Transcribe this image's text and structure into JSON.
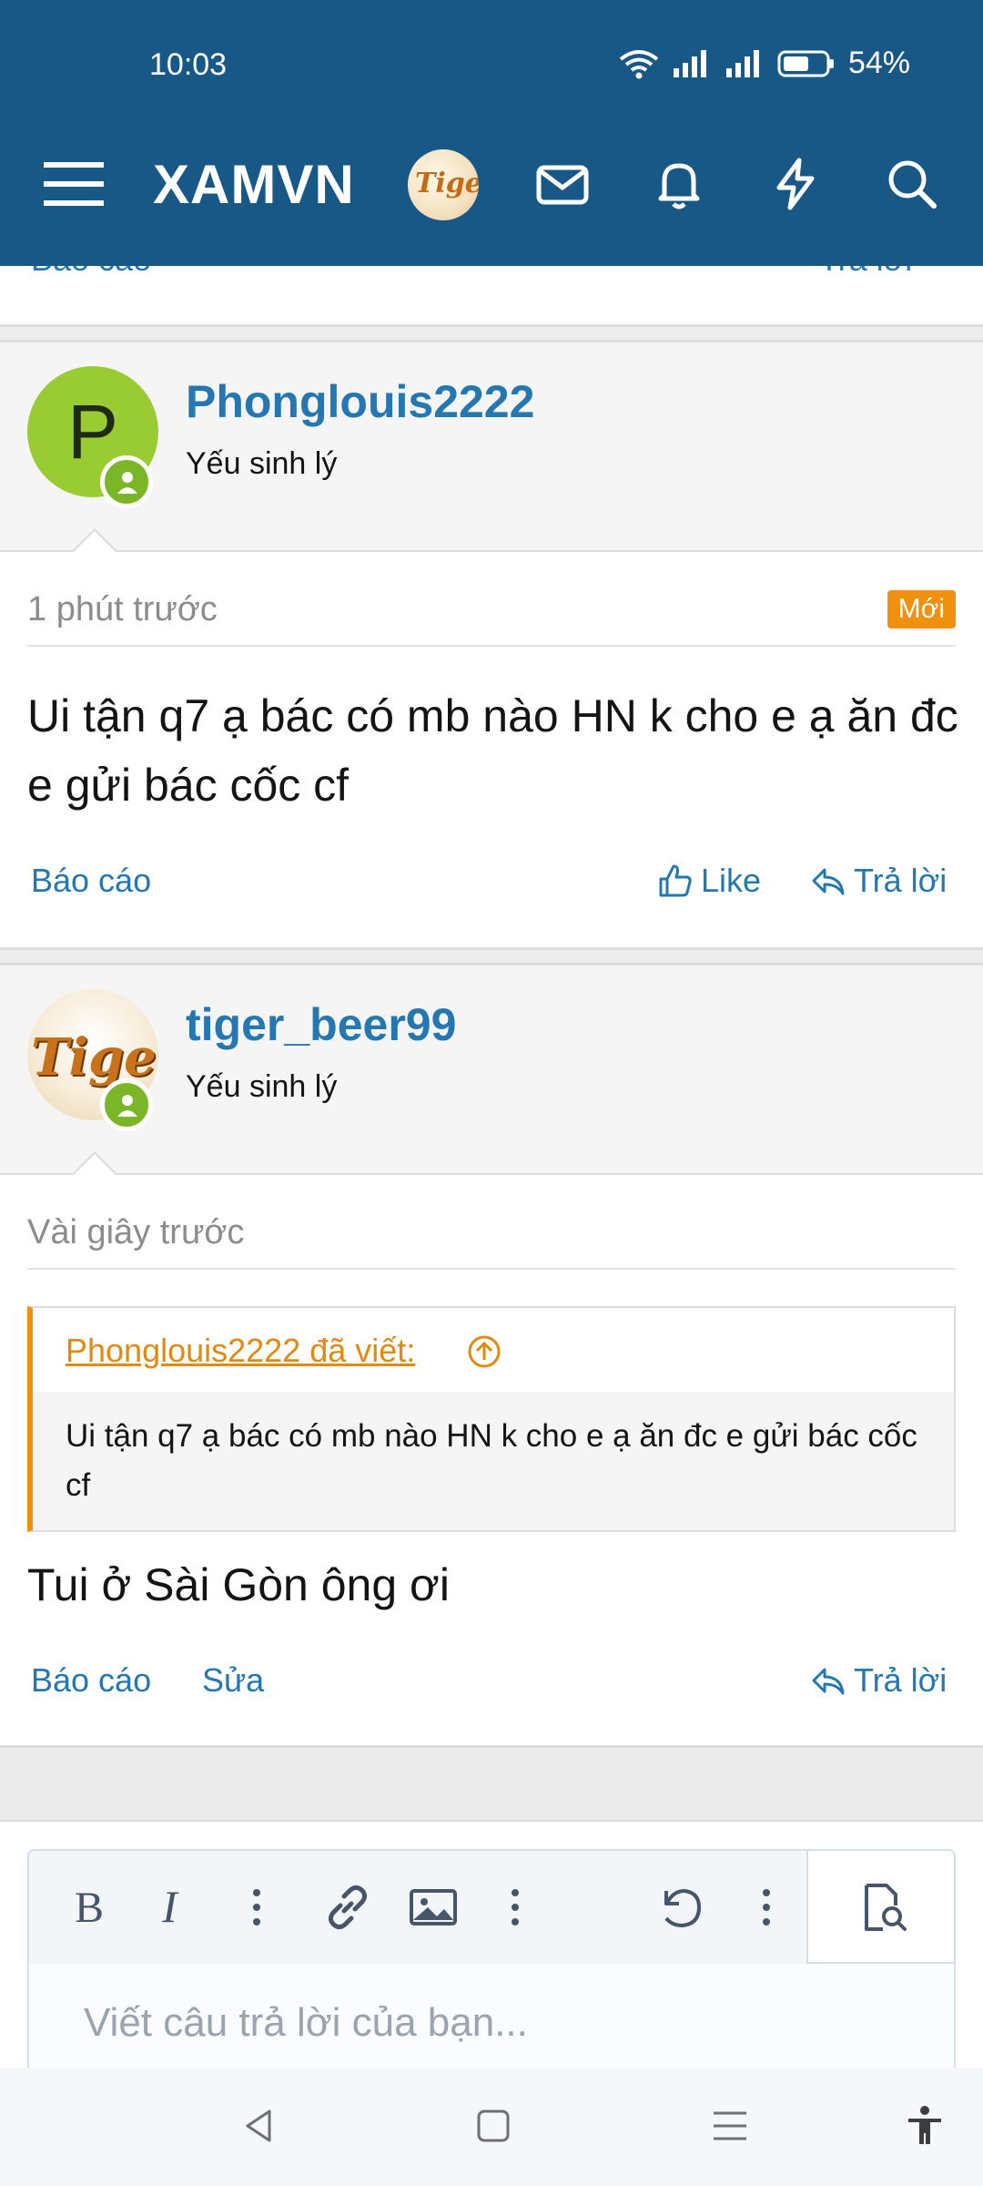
{
  "status_bar": {
    "time": "10:03",
    "battery": "54%"
  },
  "app_bar": {
    "brand": "XAMVN",
    "logo_text": "Tiger",
    "icons": [
      "menu-icon",
      "mail-icon",
      "bell-icon",
      "lightning-icon",
      "search-icon"
    ]
  },
  "prev_post": {
    "report": "Báo cáo",
    "reply": "Trả lời"
  },
  "posts": [
    {
      "avatar_letter": "P",
      "username": "Phonglouis2222",
      "user_title": "Yếu sinh lý",
      "time": "1 phút trước",
      "badge": "Mới",
      "text": "Ui tận q7 ạ bác có mb nào HN k cho e ạ ăn đc e gửi bác cốc cf",
      "actions": {
        "report": "Báo cáo",
        "like": "Like",
        "reply": "Trả lời"
      }
    },
    {
      "avatar_text": "Tiger",
      "username": "tiger_beer99",
      "user_title": "Yếu sinh lý",
      "time": "Vài giây trước",
      "quote": {
        "author_line": "Phonglouis2222 đã viết:",
        "text": "Ui tận q7 ạ bác có mb nào HN k cho e ạ ăn đc e gửi bác cốc cf"
      },
      "text": "Tui ở Sài Gòn ông ơi",
      "actions": {
        "report": "Báo cáo",
        "edit": "Sửa",
        "reply": "Trả lời"
      }
    }
  ],
  "editor": {
    "placeholder": "Viết câu trả lời của bạn...",
    "tools": [
      "bold-icon",
      "italic-icon",
      "more-icon",
      "link-icon",
      "image-icon",
      "more-icon",
      "undo-icon",
      "more-icon",
      "preview-icon"
    ]
  },
  "nav_bar": [
    "back-icon",
    "home-icon",
    "recents-icon",
    "accessibility-icon"
  ],
  "colors": {
    "header": "#185886",
    "link": "#2577b1",
    "accent": "#f0900e",
    "online": "#7ab628"
  }
}
